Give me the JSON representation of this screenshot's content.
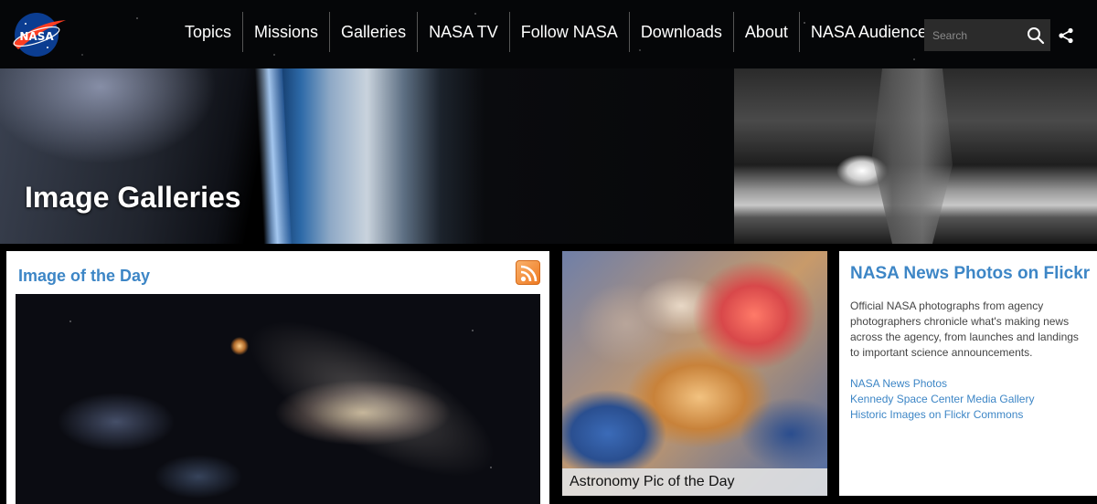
{
  "brand": {
    "logo_text": "NASA"
  },
  "nav": {
    "items": [
      {
        "label": "Topics"
      },
      {
        "label": "Missions"
      },
      {
        "label": "Galleries"
      },
      {
        "label": "NASA TV"
      },
      {
        "label": "Follow NASA"
      },
      {
        "label": "Downloads"
      },
      {
        "label": "About"
      },
      {
        "label": "NASA Audiences"
      }
    ],
    "search": {
      "placeholder": "Search",
      "icon": "search-icon"
    },
    "share_icon": "share-icon"
  },
  "hero": {
    "title": "Image Galleries"
  },
  "image_of_the_day": {
    "title": "Image of the Day",
    "feed_icon": "rss-icon"
  },
  "apod": {
    "caption": "Astronomy Pic of the Day"
  },
  "flickr": {
    "title": "NASA News Photos on Flickr",
    "description": "Official NASA photographs from agency photographers chronicle what's making news across the agency, from launches and landings to important science announcements.",
    "links": [
      {
        "label": "NASA News Photos"
      },
      {
        "label": "Kennedy Space Center Media Gallery"
      },
      {
        "label": "Historic Images on Flickr Commons"
      }
    ]
  },
  "colors": {
    "link_blue": "#3d86c6",
    "rss_orange": "#ef7a22",
    "nav_bg": "#050608"
  }
}
